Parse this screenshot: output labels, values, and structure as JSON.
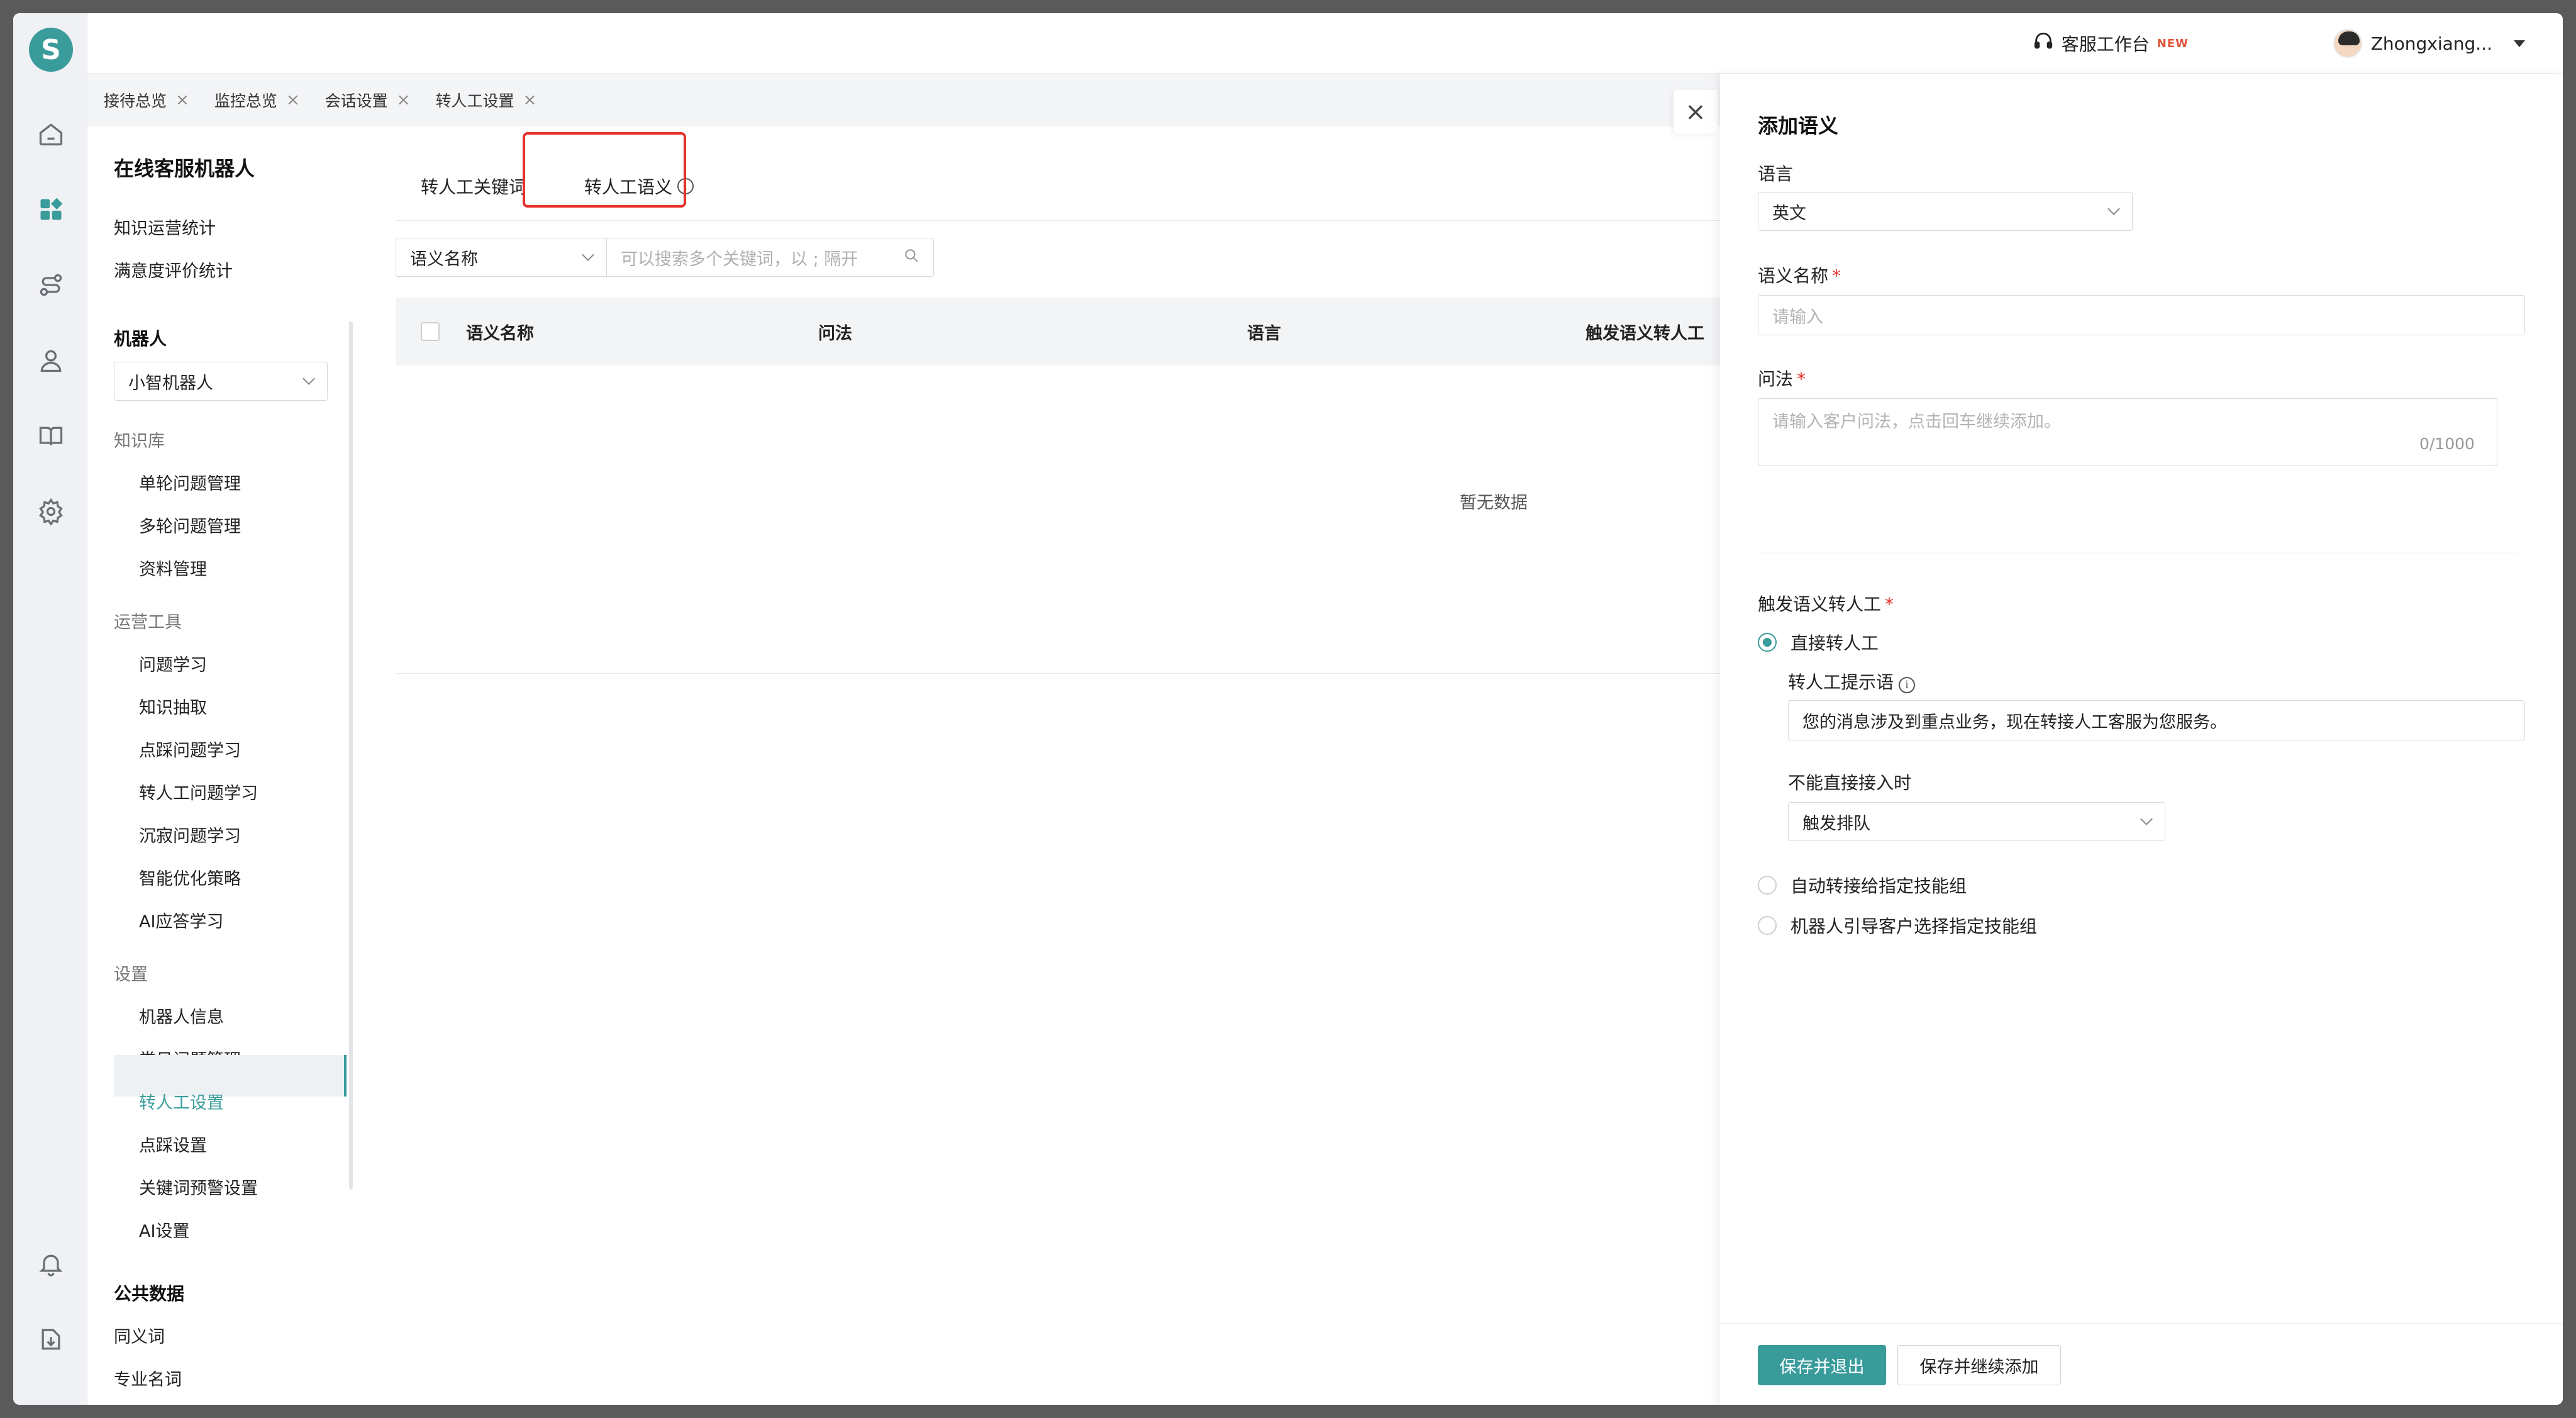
{
  "topbar": {
    "service_label": "客服工作台",
    "new_badge": "NEW",
    "user_name": "Zhongxiang..."
  },
  "tabs": [
    {
      "label": "接待总览"
    },
    {
      "label": "监控总览"
    },
    {
      "label": "会话设置"
    },
    {
      "label": "转人工设置"
    }
  ],
  "nav": {
    "title": "在线客服机器人",
    "top_items": [
      "知识运营统计",
      "满意度评价统计"
    ],
    "robot_section": "机器人",
    "robot_selected": "小智机器人",
    "knowledge_group": "知识库",
    "knowledge_items": [
      "单轮问题管理",
      "多轮问题管理",
      "资料管理"
    ],
    "ops_group": "运营工具",
    "ops_items": [
      "问题学习",
      "知识抽取",
      "点踩问题学习",
      "转人工问题学习",
      "沉寂问题学习",
      "智能优化策略",
      "AI应答学习"
    ],
    "settings_group": "设置",
    "settings_items": [
      "机器人信息",
      "常见问题管理",
      "转人工设置",
      "点踩设置",
      "关键词预警设置",
      "AI设置"
    ],
    "public_section": "公共数据",
    "public_items": [
      "同义词",
      "专业名词"
    ]
  },
  "main": {
    "subtab_keywords": "转人工关键词",
    "subtab_semantics": "转人工语义",
    "filter_select": "语义名称",
    "search_placeholder": "可以搜索多个关键词，以 ; 隔开",
    "columns": [
      "语义名称",
      "问法",
      "语言",
      "触发语义转人工"
    ],
    "empty_text": "暂无数据"
  },
  "drawer": {
    "title": "添加语义",
    "language_label": "语言",
    "language_value": "英文",
    "name_label": "语义名称",
    "name_placeholder": "请输入",
    "question_label": "问法",
    "question_placeholder": "请输入客户问法，点击回车继续添加。",
    "question_counter": "0/1000",
    "trigger_label": "触发语义转人工",
    "option_direct": "直接转人工",
    "prompt_label": "转人工提示语",
    "prompt_value": "您的消息涉及到重点业务，现在转接人工客服为您服务。",
    "cannot_connect_label": "不能直接接入时",
    "cannot_connect_value": "触发排队",
    "option_auto_skill": "自动转接给指定技能组",
    "option_guide_skill": "机器人引导客户选择指定技能组",
    "save_exit": "保存并退出",
    "save_continue": "保存并继续添加"
  },
  "colors": {
    "accent": "#3a9b9b",
    "highlight_border": "#e5322d",
    "required": "#e5322d"
  }
}
